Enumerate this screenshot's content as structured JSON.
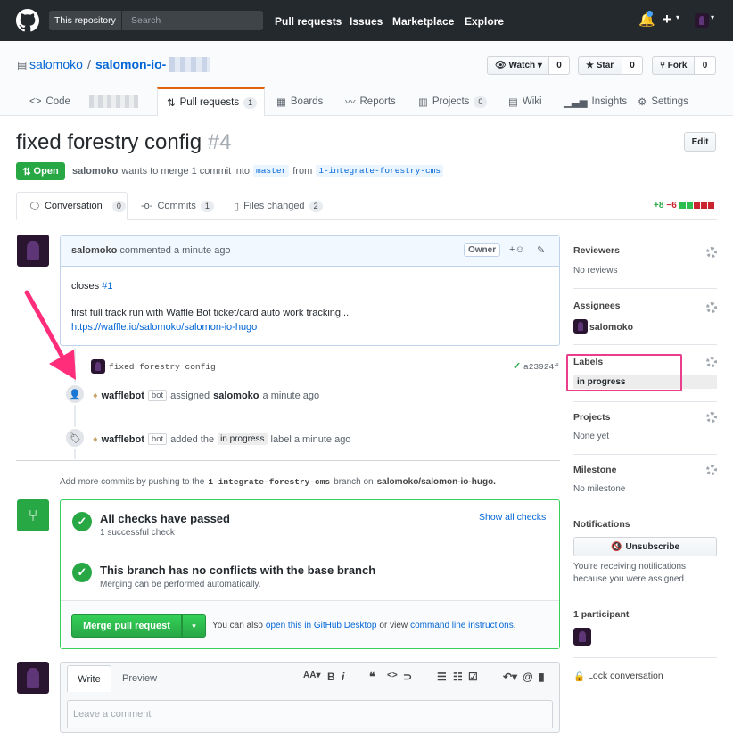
{
  "nav": {
    "scope_label": "This repository",
    "search_placeholder": "Search",
    "links": [
      "Pull requests",
      "Issues",
      "Marketplace",
      "Explore"
    ]
  },
  "repo": {
    "owner": "salomoko",
    "name": "salomon-io-",
    "watch_label": "Watch",
    "watch_count": "0",
    "star_label": "Star",
    "star_count": "0",
    "fork_label": "Fork",
    "fork_count": "0"
  },
  "tabs": [
    {
      "label": "Code"
    },
    {
      "label": "Pull requests",
      "count": "1"
    },
    {
      "label": "Boards"
    },
    {
      "label": "Reports"
    },
    {
      "label": "Projects",
      "count": "0"
    },
    {
      "label": "Wiki"
    },
    {
      "label": "Insights"
    },
    {
      "label": "Settings"
    }
  ],
  "pr": {
    "title": "fixed forestry config",
    "number": "#4",
    "state": "Open",
    "author": "salomoko",
    "meta_text": "wants to merge 1 commit into",
    "base": "master",
    "from_text": "from",
    "head": "1-integrate-forestry-cms",
    "edit_label": "Edit"
  },
  "pr_tabs": [
    {
      "label": "Conversation",
      "count": "0"
    },
    {
      "label": "Commits",
      "count": "1"
    },
    {
      "label": "Files changed",
      "count": "2"
    }
  ],
  "diffstat": {
    "additions": "+8",
    "deletions": "−6"
  },
  "comment": {
    "author": "salomoko",
    "action": "commented a minute ago",
    "owner_label": "Owner",
    "body_closes": "closes",
    "issue_ref": "#1",
    "body_line": "first full track run with Waffle Bot ticket/card auto work tracking...",
    "link": "https://waffle.io/salomoko/salomon-io-hugo"
  },
  "commit": {
    "message": "fixed forestry config",
    "sha": "a23924f"
  },
  "events": [
    {
      "actor": "wafflebot",
      "tag": "bot",
      "text": "assigned",
      "target": "salomoko",
      "time": "a minute ago"
    },
    {
      "actor": "wafflebot",
      "tag": "bot",
      "text": "added the",
      "label": "in progress",
      "time": "label a minute ago"
    }
  ],
  "push_hint": {
    "pre": "Add more commits by pushing to the",
    "branch": "1-integrate-forestry-cms",
    "mid": "branch on",
    "repo": "salomoko/salomon-io-hugo."
  },
  "merge": {
    "checks_title": "All checks have passed",
    "checks_sub": "1 successful check",
    "show_checks": "Show all checks",
    "conflict_title": "This branch has no conflicts with the base branch",
    "conflict_sub": "Merging can be performed automatically.",
    "merge_button": "Merge pull request",
    "also_text": "You can also",
    "desktop_link": "open this in GitHub Desktop",
    "or_text": "or view",
    "cli_link": "command line instructions",
    "period": "."
  },
  "editor": {
    "write_tab": "Write",
    "preview_tab": "Preview",
    "placeholder": "Leave a comment"
  },
  "sidebar": {
    "reviewers_title": "Reviewers",
    "reviewers_val": "No reviews",
    "assignees_title": "Assignees",
    "assignee": "salomoko",
    "labels_title": "Labels",
    "label": "in progress",
    "projects_title": "Projects",
    "projects_val": "None yet",
    "milestone_title": "Milestone",
    "milestone_val": "No milestone",
    "notifications_title": "Notifications",
    "unsubscribe": "Unsubscribe",
    "notif_line1": "You're receiving notifications",
    "notif_line2": "because you were assigned.",
    "participants": "1 participant",
    "lock": "Lock conversation"
  },
  "colors": {
    "header": "#24292e",
    "green": "#28a745",
    "highlight": "#e83e8c",
    "link": "#0366d6"
  }
}
